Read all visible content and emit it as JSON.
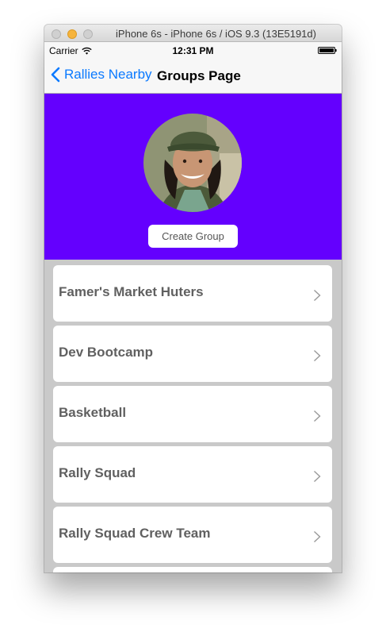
{
  "simulator": {
    "title": "iPhone 6s - iPhone 6s / iOS 9.3 (13E5191d)"
  },
  "status_bar": {
    "carrier": "Carrier",
    "time": "12:31 PM"
  },
  "nav": {
    "back_label": "Rallies Nearby",
    "title": "Groups Page"
  },
  "header": {
    "background_color": "#6400fe",
    "create_button_label": "Create Group"
  },
  "groups": [
    {
      "name": "Famer's Market Huters"
    },
    {
      "name": "Dev Bootcamp"
    },
    {
      "name": "Basketball"
    },
    {
      "name": "Rally Squad"
    },
    {
      "name": "Rally Squad Crew Team"
    }
  ],
  "colors": {
    "ios_blue": "#0a7aff",
    "list_background": "#c9c9c9",
    "group_text": "#606060"
  }
}
